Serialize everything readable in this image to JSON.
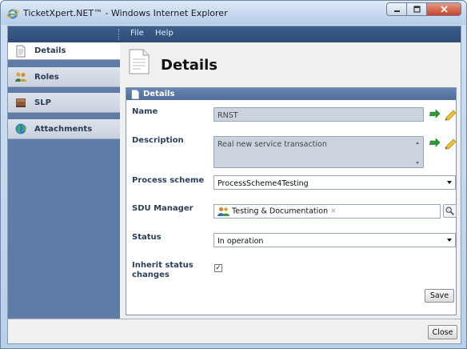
{
  "window": {
    "title": "TicketXpert.NET™ - Windows Internet Explorer"
  },
  "menu": {
    "items": [
      "File",
      "Help"
    ]
  },
  "sidebar": {
    "items": [
      {
        "label": "Details",
        "icon": "document-icon"
      },
      {
        "label": "Roles",
        "icon": "users-icon"
      },
      {
        "label": "SLP",
        "icon": "book-icon"
      },
      {
        "label": "Attachments",
        "icon": "globe-icon"
      }
    ]
  },
  "page": {
    "title": "Details"
  },
  "panel": {
    "title": "Details"
  },
  "form": {
    "name": {
      "label": "Name",
      "value": "RNST"
    },
    "description": {
      "label": "Description",
      "value": "Real new service transaction"
    },
    "process_scheme": {
      "label": "Process scheme",
      "value": "ProcessScheme4Testing"
    },
    "sdu_manager": {
      "label": "SDU Manager",
      "value": "Testing & Documentation",
      "remove": "×"
    },
    "status": {
      "label": "Status",
      "value": "In operation"
    },
    "inherit": {
      "label_line1": "Inherit status",
      "label_line2": "changes",
      "checked": true,
      "mark": "✓"
    }
  },
  "buttons": {
    "save": "Save",
    "close": "Close"
  },
  "colors": {
    "menubar": "#2e4d78",
    "sidebar": "#5f7ba6",
    "panel_header": "#5a77a4",
    "label": "#2c3e5c"
  }
}
